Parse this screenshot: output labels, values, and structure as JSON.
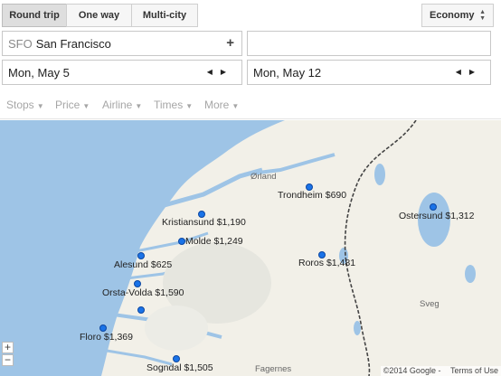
{
  "trip_types": {
    "round_trip": "Round trip",
    "one_way": "One way",
    "multi_city": "Multi-city"
  },
  "cabin": {
    "selected": "Economy"
  },
  "origin": {
    "code": "SFO",
    "city": "San Francisco",
    "add_symbol": "+"
  },
  "destination": {
    "value": ""
  },
  "depart_date": "Mon, May 5",
  "return_date": "Mon, May 12",
  "filters": {
    "stops": "Stops",
    "price": "Price",
    "airline": "Airline",
    "times": "Times",
    "more": "More"
  },
  "map": {
    "destinations": [
      {
        "name": "Trondheim",
        "price": "$690"
      },
      {
        "name": "Kristiansund",
        "price": "$1,190"
      },
      {
        "name": "Molde",
        "price": "$1,249"
      },
      {
        "name": "Alesund",
        "price": "$625"
      },
      {
        "name": "Orsta-Volda",
        "price": "$1,590"
      },
      {
        "name": "Floro",
        "price": "$1,369"
      },
      {
        "name": "Sogndal",
        "price": "$1,505"
      },
      {
        "name": "Roros",
        "price": "$1,481"
      },
      {
        "name": "Ostersund",
        "price": "$1,312"
      }
    ],
    "places": [
      "Ørland",
      "Sveg",
      "Fagernes"
    ],
    "zoom_in": "+",
    "zoom_out": "−",
    "copyright": "©2014 Google -",
    "terms": "Terms of Use",
    "water_color": "#9ec4e6",
    "land_color": "#f2f0e8"
  }
}
